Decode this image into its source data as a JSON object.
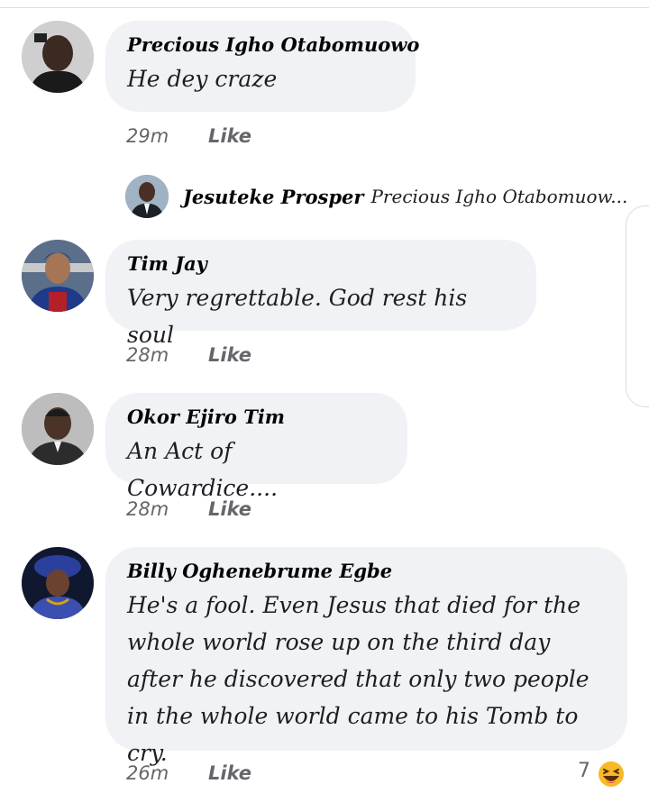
{
  "comments": [
    {
      "author": "Precious Igho Otabomuowo",
      "text": "He dey craze",
      "time": "29m",
      "like_label": "Like",
      "avatar_icon": "man-in-black-avatar"
    },
    {
      "author": "Tim Jay",
      "text": "Very regrettable. God rest his soul",
      "time": "28m",
      "like_label": "Like",
      "avatar_icon": "footballer-avatar"
    },
    {
      "author": "Okor Ejiro Tim",
      "text": "An Act of Cowardice....",
      "time": "28m",
      "like_label": "Like",
      "avatar_icon": "man-portrait-avatar"
    },
    {
      "author": "Billy Oghenebrume Egbe",
      "text": "He's a fool. Even Jesus that died for the whole world rose up on the third day after he discovered that only two people in the whole world came to his Tomb to cry.",
      "time": "26m",
      "like_label": "Like",
      "avatar_icon": "woman-headwrap-avatar",
      "reaction_count": "7",
      "reaction_icon": "laughing-emoji-icon"
    }
  ],
  "reply": {
    "author": "Jesuteke Prosper",
    "text": "Precious Igho Otabomuow...",
    "avatar_icon": "man-in-suit-avatar"
  },
  "colors": {
    "bubble_bg": "#f0f2f5",
    "meta_text": "#65676b",
    "emoji": "#f7b928"
  }
}
